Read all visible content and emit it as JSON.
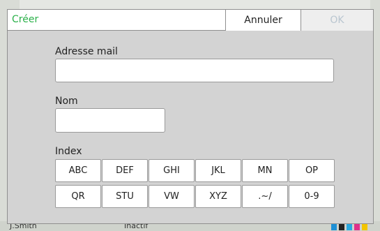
{
  "dialog": {
    "title": "Créer",
    "cancel_label": "Annuler",
    "ok_label": "OK",
    "email_label": "Adresse mail",
    "email_value": "",
    "name_label": "Nom",
    "name_value": "",
    "index_label": "Index",
    "index_keys": [
      "ABC",
      "DEF",
      "GHI",
      "JKL",
      "MN",
      "OP",
      "QR",
      "STU",
      "VW",
      "XYZ",
      ".~/",
      "0-9"
    ]
  },
  "background": {
    "user_name": "J.Smith",
    "status_text": "Inactif"
  },
  "colors": {
    "title_green": "#2bb14a",
    "ok_disabled": "#b9c6d0",
    "dialog_body": "#d3d3d3"
  }
}
